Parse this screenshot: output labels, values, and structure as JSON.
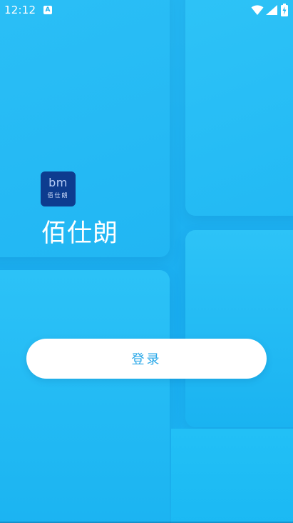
{
  "status_bar": {
    "time": "12:12",
    "notification_badge": "A",
    "icons": [
      "wifi-icon",
      "cell-signal-icon",
      "battery-icon"
    ]
  },
  "app": {
    "logo_mark": "bm",
    "logo_subtext": "佰仕朗",
    "name": "佰仕朗"
  },
  "login": {
    "button_label": "登录"
  },
  "colors": {
    "background": "#1fb2f1",
    "panel": "#2bbff6",
    "button_bg": "#ffffff",
    "button_text": "#2aa8e8",
    "logo_bg": "#0d3c8f"
  }
}
